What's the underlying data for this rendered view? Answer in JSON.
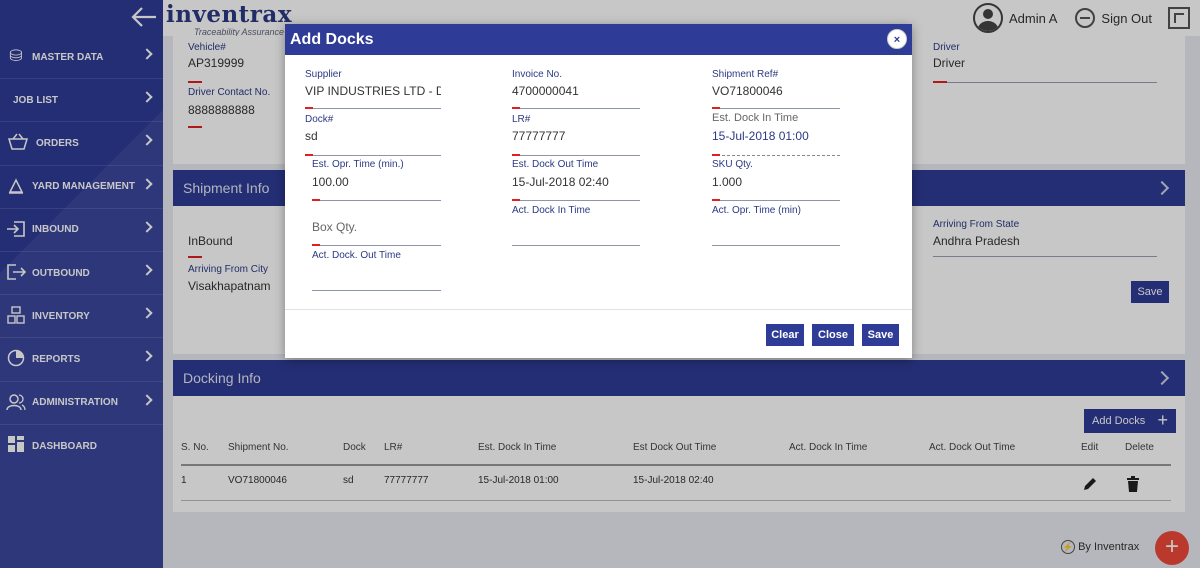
{
  "app": {
    "logo_main": "inventrax",
    "logo_tagline": "Traceability Assurance"
  },
  "topbar": {
    "user_name": "Admin A",
    "signout_label": "Sign Out"
  },
  "sidebar": {
    "items": [
      {
        "label": "MASTER DATA",
        "icon": "database-icon"
      },
      {
        "label": "JOB LIST",
        "icon": ""
      },
      {
        "label": "ORDERS",
        "icon": "basket-icon"
      },
      {
        "label": "YARD MANAGEMENT",
        "icon": "yard-icon"
      },
      {
        "label": "INBOUND",
        "icon": "inbound-icon"
      },
      {
        "label": "OUTBOUND",
        "icon": "outbound-icon"
      },
      {
        "label": "INVENTORY",
        "icon": "inventory-icon"
      },
      {
        "label": "REPORTS",
        "icon": "pie-chart-icon"
      },
      {
        "label": "ADMINISTRATION",
        "icon": "users-icon"
      },
      {
        "label": "DASHBOARD",
        "icon": "grid-icon"
      }
    ]
  },
  "vehicle_section": {
    "vehicle_label": "Vehicle#",
    "vehicle_value": "AP319999",
    "driver_contact_label": "Driver Contact No.",
    "driver_contact_value": "8888888888",
    "driver_label": "Driver",
    "driver_value": "Driver"
  },
  "shipment_info": {
    "title": "Shipment Info",
    "inbound_value": "InBound",
    "arriving_city_label": "Arriving From City",
    "arriving_city_value": "Visakhapatnam",
    "arriving_state_label": "Arriving From State",
    "arriving_state_value": "Andhra Pradesh",
    "save_label": "Save"
  },
  "docking_info": {
    "title": "Docking Info",
    "add_docks_label": "Add Docks",
    "columns": [
      "S. No.",
      "Shipment No.",
      "Dock",
      "LR#",
      "Est. Dock In Time",
      "Est Dock Out Time",
      "Act. Dock In Time",
      "Act. Dock Out Time",
      "Edit",
      "Delete"
    ],
    "rows": [
      {
        "sno": "1",
        "shipment_no": "VO71800046",
        "dock": "sd",
        "lr": "77777777",
        "est_in": "15-Jul-2018 01:00",
        "est_out": "15-Jul-2018 02:40"
      }
    ]
  },
  "footer": {
    "brand": "By Inventrax"
  },
  "modal": {
    "title": "Add Docks",
    "supplier_label": "Supplier",
    "supplier_value": "VIP INDUSTRIES LTD - DI",
    "invoice_label": "Invoice No.",
    "invoice_value": "4700000041",
    "shipment_ref_label": "Shipment Ref#",
    "shipment_ref_value": "VO71800046",
    "dock_label": "Dock#",
    "dock_value": "sd",
    "lr_label": "LR#",
    "lr_value": "77777777",
    "est_dock_in_label": "Est. Dock In Time",
    "est_dock_in_value": "15-Jul-2018 01:00",
    "est_opr_label": "Est. Opr. Time (min.)",
    "est_opr_value": "100.00",
    "est_dock_out_label": "Est. Dock Out Time",
    "est_dock_out_value": "15-Jul-2018 02:40",
    "sku_label": "SKU Qty.",
    "sku_value": "1.000",
    "box_qty_placeholder": "Box Qty.",
    "act_dock_in_label": "Act. Dock In Time",
    "act_opr_label": "Act. Opr. Time (min)",
    "act_dock_out_label": "Act. Dock. Out Time",
    "clear_label": "Clear",
    "close_label": "Close",
    "save_label": "Save"
  }
}
